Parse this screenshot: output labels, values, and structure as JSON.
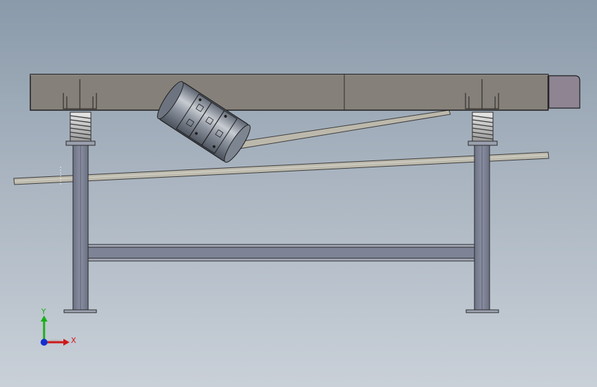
{
  "triad": {
    "x_label": "X",
    "y_label": "Y",
    "x_color": "#d01818",
    "y_color": "#18b018",
    "z_color": "#1030d0"
  },
  "colors": {
    "trough": "#858079",
    "trough_edge": "#2a2a2a",
    "end_cap": "#8e8492",
    "leg": "#7e8496",
    "spring": "#c8c8c8",
    "bar": "#bcb9ac",
    "motor": "#7d8590"
  }
}
